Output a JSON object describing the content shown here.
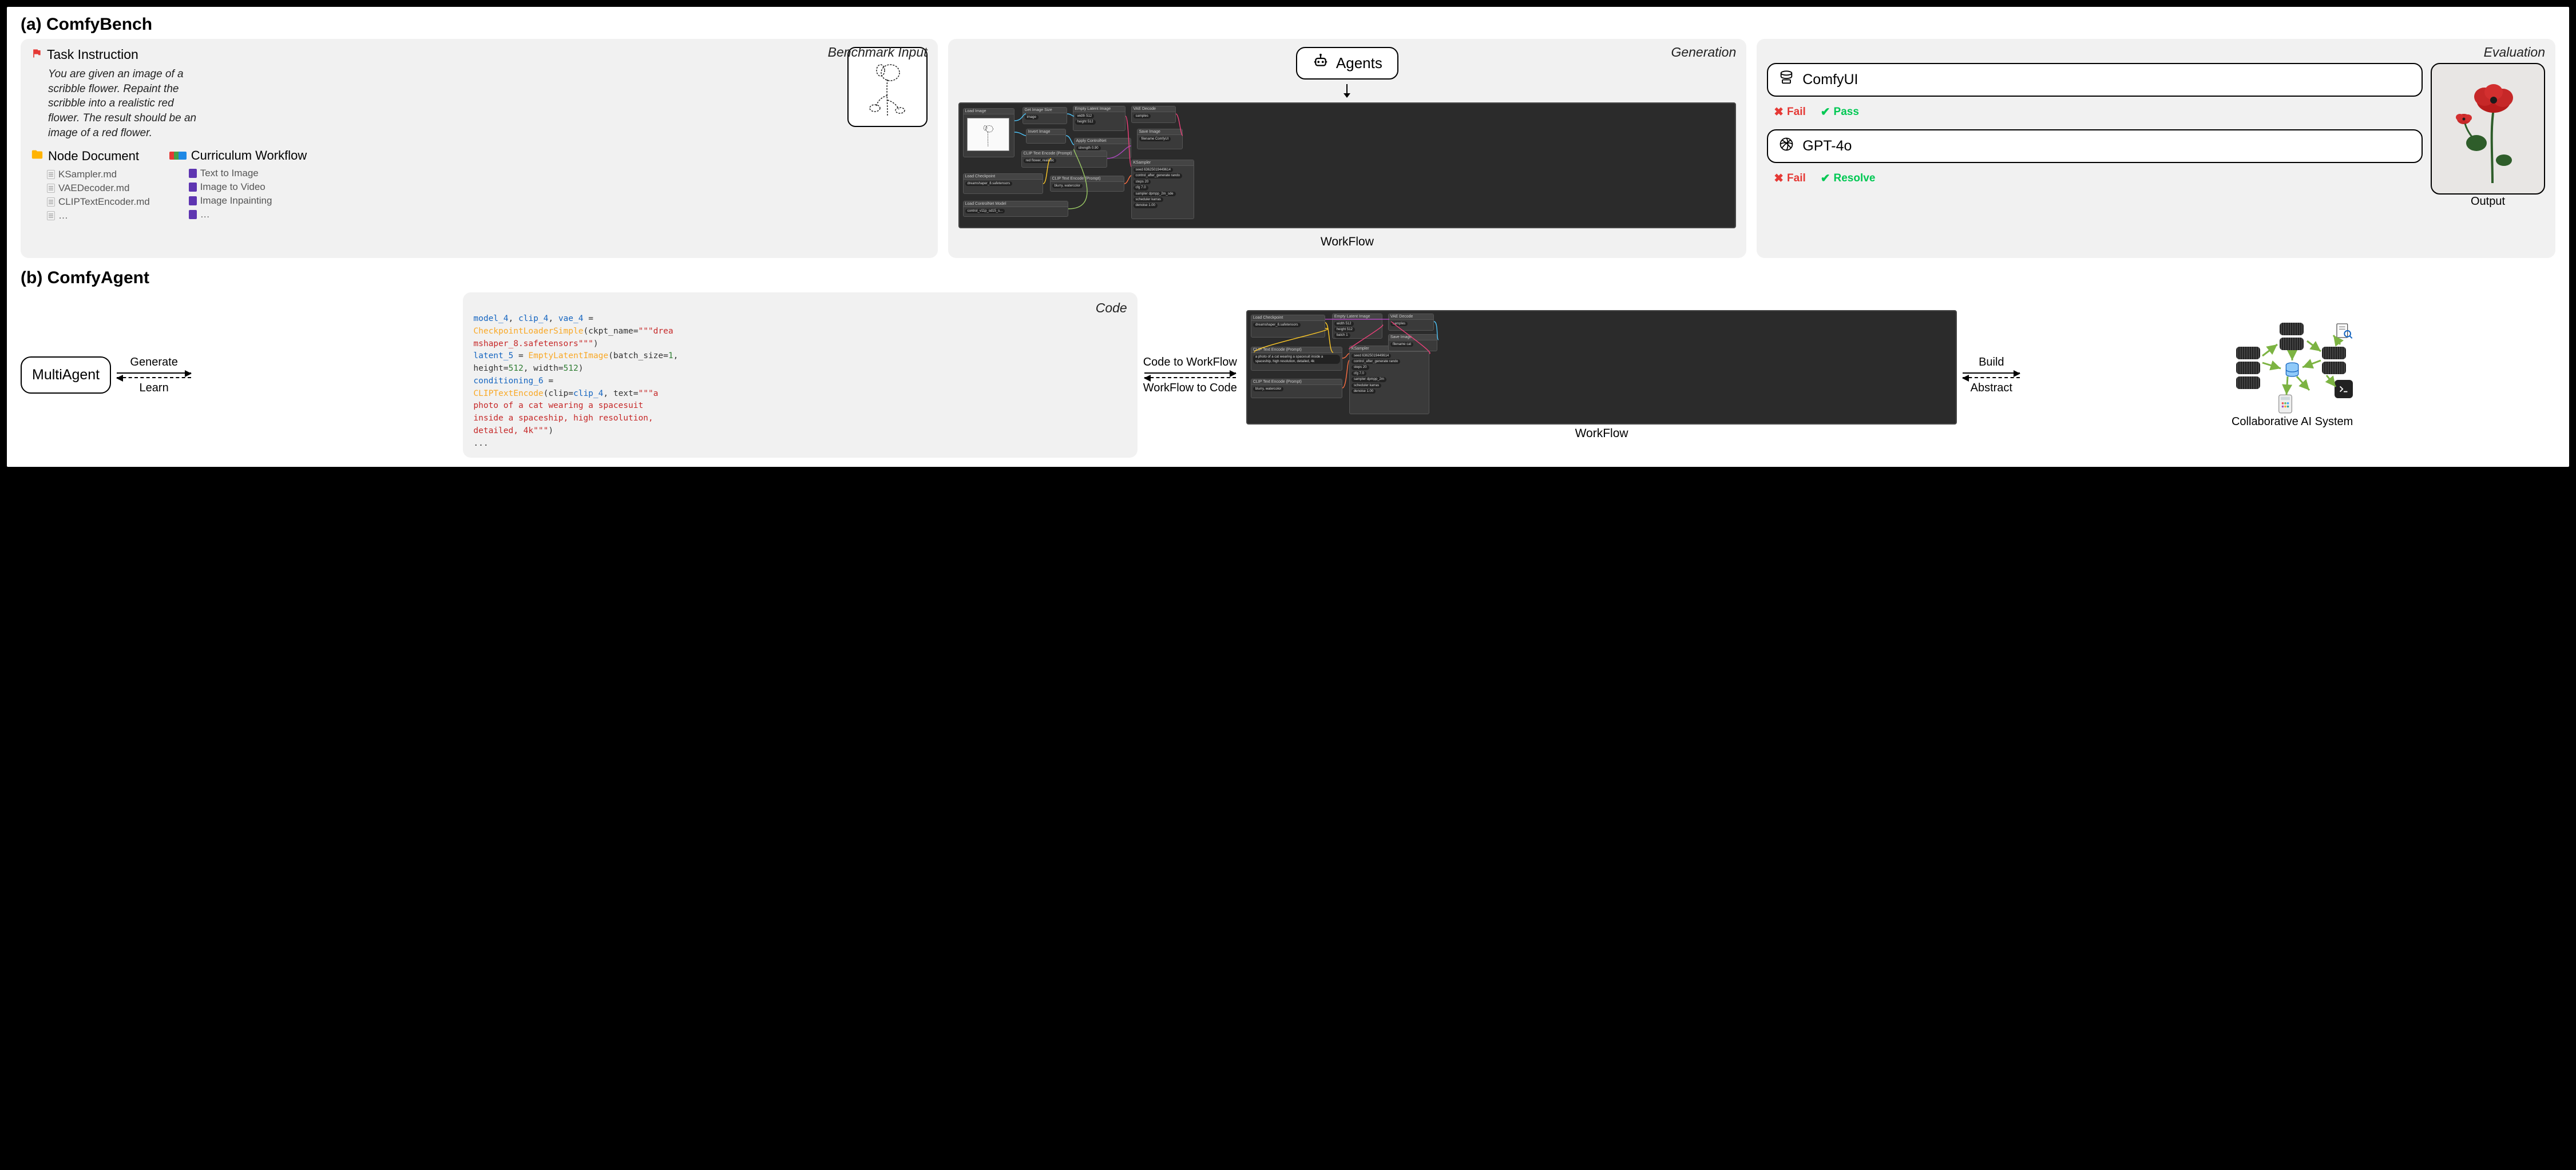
{
  "section_a_title": "(a) ComfyBench",
  "section_b_title": "(b) ComfyAgent",
  "benchmark": {
    "panel_label": "Benchmark Input",
    "task_heading": "Task Instruction",
    "task_text": "You are given an image of a scribble flower. Repaint the scribble into a realistic red flower. The result should be an image of a red flower.",
    "node_doc_heading": "Node Document",
    "node_docs": [
      "KSampler.md",
      "VAEDecoder.md",
      "CLIPTextEncoder.md",
      "…"
    ],
    "curriculum_heading": "Curriculum Workflow",
    "curriculum": [
      "Text to Image",
      "Image to Video",
      "Image Inpainting",
      "…"
    ]
  },
  "generation": {
    "panel_label": "Generation",
    "agents_label": "Agents",
    "workflow_caption": "WorkFlow",
    "nodes": [
      "Load Image",
      "Get Image Size",
      "Empty Latent Image",
      "VAE Decode",
      "Invert Image",
      "Apply ControlNet",
      "Save Image",
      "CLIP Text Encode (Prompt)",
      "Load Checkpoint",
      "CLIP Text Encode (Prompt)",
      "KSampler",
      "Load ControlNet Model"
    ]
  },
  "evaluation": {
    "panel_label": "Evaluation",
    "comfyui_label": "ComfyUI",
    "gpt4o_label": "GPT-4o",
    "fail_label": "Fail",
    "pass_label": "Pass",
    "resolve_label": "Resolve",
    "output_caption": "Output"
  },
  "agent": {
    "multiagent_label": "MultiAgent",
    "generate_label": "Generate",
    "learn_label": "Learn",
    "code_panel_label": "Code",
    "code_to_wf_label": "Code to WorkFlow",
    "wf_to_code_label": "WorkFlow to Code",
    "build_label": "Build",
    "abstract_label": "Abstract",
    "workflow_caption": "WorkFlow",
    "collab_caption": "Collaborative AI System",
    "workflow_nodes": [
      "Load Checkpoint",
      "Empty Latent Image",
      "VAE Decode",
      "CLIP Text Encode (Prompt)",
      "KSampler",
      "Save Image",
      "CLIP Text Encode (Prompt)"
    ],
    "code_tokens": [
      {
        "t": "var",
        "s": "model_4"
      },
      {
        "t": "plain",
        "s": ", "
      },
      {
        "t": "var",
        "s": "clip_4"
      },
      {
        "t": "plain",
        "s": ", "
      },
      {
        "t": "var",
        "s": "vae_4"
      },
      {
        "t": "plain",
        "s": " = "
      },
      {
        "t": "br"
      },
      {
        "t": "fn",
        "s": "CheckpointLoaderSimple"
      },
      {
        "t": "plain",
        "s": "(ckpt_name="
      },
      {
        "t": "str",
        "s": "\"\"\"drea"
      },
      {
        "t": "br"
      },
      {
        "t": "str",
        "s": "mshaper_8.safetensors\"\"\""
      },
      {
        "t": "plain",
        "s": ")"
      },
      {
        "t": "br"
      },
      {
        "t": "var",
        "s": "latent_5"
      },
      {
        "t": "plain",
        "s": " = "
      },
      {
        "t": "fn",
        "s": "EmptyLatentImage"
      },
      {
        "t": "plain",
        "s": "(batch_size="
      },
      {
        "t": "num",
        "s": "1"
      },
      {
        "t": "plain",
        "s": ", "
      },
      {
        "t": "br"
      },
      {
        "t": "plain",
        "s": "height="
      },
      {
        "t": "num",
        "s": "512"
      },
      {
        "t": "plain",
        "s": ", width="
      },
      {
        "t": "num",
        "s": "512"
      },
      {
        "t": "plain",
        "s": ")"
      },
      {
        "t": "br"
      },
      {
        "t": "var",
        "s": "conditioning_6"
      },
      {
        "t": "plain",
        "s": " = "
      },
      {
        "t": "br"
      },
      {
        "t": "fn",
        "s": "CLIPTextEncode"
      },
      {
        "t": "plain",
        "s": "(clip="
      },
      {
        "t": "var",
        "s": "clip_4"
      },
      {
        "t": "plain",
        "s": ", text="
      },
      {
        "t": "str",
        "s": "\"\"\"a "
      },
      {
        "t": "br"
      },
      {
        "t": "str",
        "s": "photo of a cat wearing a spacesuit "
      },
      {
        "t": "br"
      },
      {
        "t": "str",
        "s": "inside a spaceship, high resolution, "
      },
      {
        "t": "br"
      },
      {
        "t": "str",
        "s": "detailed, 4k\"\"\""
      },
      {
        "t": "plain",
        "s": ")"
      },
      {
        "t": "br"
      },
      {
        "t": "plain",
        "s": "..."
      }
    ]
  }
}
